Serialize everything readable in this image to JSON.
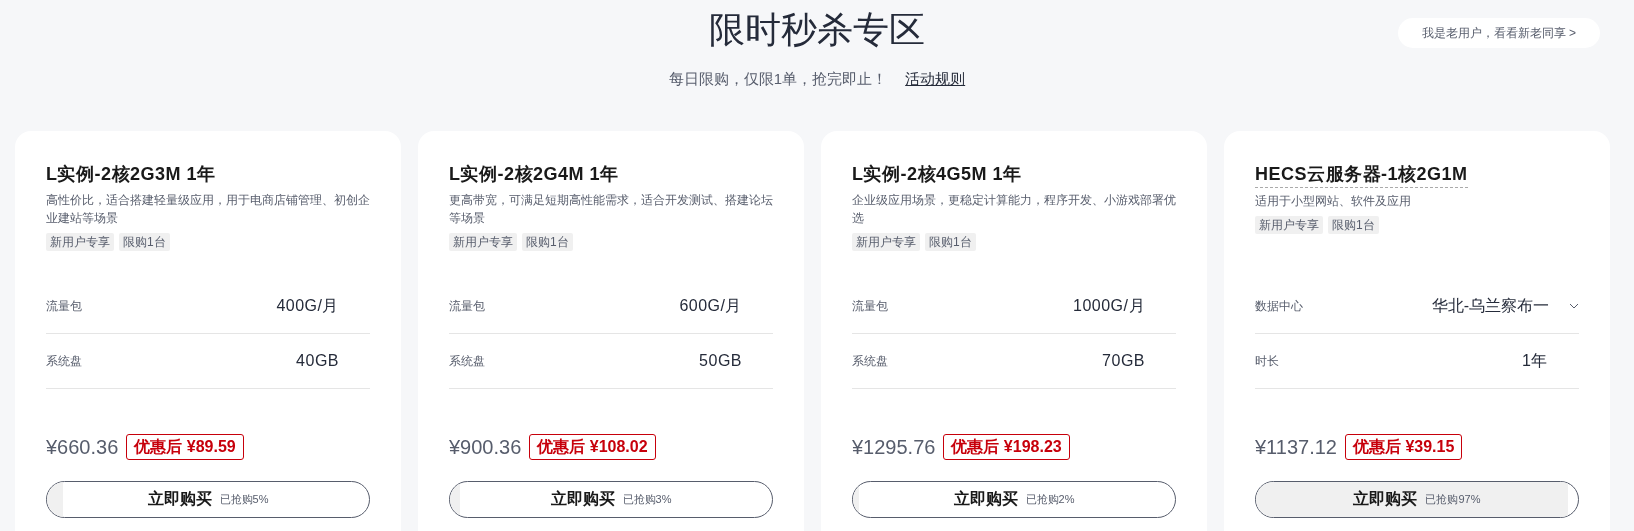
{
  "header": {
    "title": "限时秒杀专区",
    "subtitle": "每日限购，仅限1单，抢完即止！",
    "rules_link": "活动规则",
    "old_user_button": "我是老用户，看看新老同享 >"
  },
  "cards": [
    {
      "title": "L实例-2核2G3M 1年",
      "underlined": false,
      "description": "高性价比，适合搭建轻量级应用，用于电商店铺管理、初创企业建站等场景",
      "tags": [
        "新用户专享",
        "限购1台"
      ],
      "specs": [
        {
          "kind": "text",
          "label": "流量包",
          "value": "400G/月"
        },
        {
          "kind": "text",
          "label": "系统盘",
          "value": "40GB"
        }
      ],
      "original_price": "¥660.36",
      "discount_price": "优惠后 ¥89.59",
      "buy_label": "立即购买",
      "sold": "已抢购5%",
      "level": 0.05
    },
    {
      "title": "L实例-2核2G4M 1年",
      "underlined": false,
      "description": "更高带宽，可满足短期高性能需求，适合开发测试、搭建论坛等场景",
      "tags": [
        "新用户专享",
        "限购1台"
      ],
      "specs": [
        {
          "kind": "text",
          "label": "流量包",
          "value": "600G/月"
        },
        {
          "kind": "text",
          "label": "系统盘",
          "value": "50GB"
        }
      ],
      "original_price": "¥900.36",
      "discount_price": "优惠后 ¥108.02",
      "buy_label": "立即购买",
      "sold": "已抢购3%",
      "level": 0.03
    },
    {
      "title": "L实例-2核4G5M 1年",
      "underlined": false,
      "description": "企业级应用场景，更稳定计算能力，程序开发、小游戏部署优选",
      "tags": [
        "新用户专享",
        "限购1台"
      ],
      "specs": [
        {
          "kind": "text",
          "label": "流量包",
          "value": "1000G/月"
        },
        {
          "kind": "text",
          "label": "系统盘",
          "value": "70GB"
        }
      ],
      "original_price": "¥1295.76",
      "discount_price": "优惠后 ¥198.23",
      "buy_label": "立即购买",
      "sold": "已抢购2%",
      "level": 0.02
    },
    {
      "title": "HECS云服务器-1核2G1M",
      "underlined": true,
      "description": "适用于小型网站、软件及应用",
      "tags": [
        "新用户专享",
        "限购1台"
      ],
      "specs": [
        {
          "kind": "select",
          "label": "数据中心",
          "value": "华北-乌兰察布一"
        },
        {
          "kind": "text",
          "label": "时长",
          "value": "1年"
        }
      ],
      "original_price": "¥1137.12",
      "discount_price": "优惠后 ¥39.15",
      "buy_label": "立即购买",
      "sold": "已抢购97%",
      "level": 0.97
    }
  ]
}
